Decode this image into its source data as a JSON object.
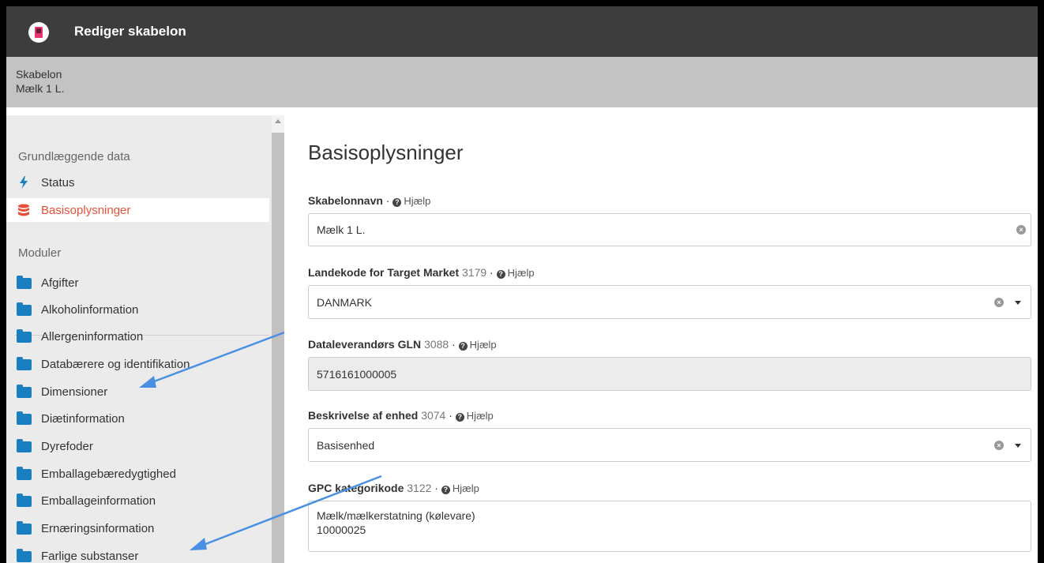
{
  "window": {
    "title": "Rediger skabelon"
  },
  "subheader": {
    "label": "Skabelon",
    "value": "Mælk 1 L."
  },
  "sidebar": {
    "section1": "Grundlæggende data",
    "items1": [
      {
        "label": "Status",
        "icon": "bolt-icon"
      },
      {
        "label": "Basisoplysninger",
        "icon": "database-icon"
      }
    ],
    "section2": "Moduler",
    "items2": [
      {
        "label": "Afgifter"
      },
      {
        "label": "Alkoholinformation"
      },
      {
        "label": "Allergeninformation"
      },
      {
        "label": "Databærere og identifikation"
      },
      {
        "label": "Dimensioner"
      },
      {
        "label": "Diætinformation"
      },
      {
        "label": "Dyrefoder"
      },
      {
        "label": "Emballagebæredygtighed"
      },
      {
        "label": "Emballageinformation"
      },
      {
        "label": "Ernæringsinformation"
      },
      {
        "label": "Farlige substanser"
      }
    ]
  },
  "main": {
    "title": "Basisoplysninger",
    "help": "Hjælp",
    "fields": [
      {
        "label": "Skabelonnavn",
        "code": "",
        "value": "Mælk 1 L."
      },
      {
        "label": "Landekode for Target Market",
        "code": "3179",
        "value": "DANMARK"
      },
      {
        "label": "Dataleverandørs GLN",
        "code": "3088",
        "value": "5716161000005"
      },
      {
        "label": "Beskrivelse af enhed",
        "code": "3074",
        "value": "Basisenhed"
      },
      {
        "label": "GPC kategorikode",
        "code": "3122",
        "value": "Mælk/mælkerstatning (kølevare)",
        "value2": "10000025"
      }
    ]
  },
  "colors": {
    "accent": "#e8503a",
    "folder": "#1a7fc0",
    "annotation_arrow": "#4a90e2"
  }
}
